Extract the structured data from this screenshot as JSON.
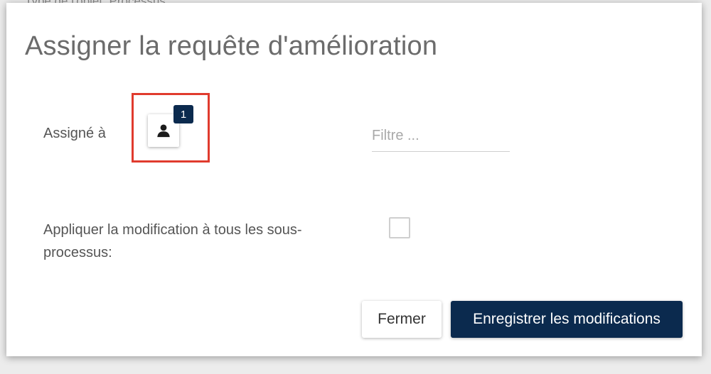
{
  "background": {
    "partial_text": "Type de l'objet: Processus"
  },
  "dialog": {
    "title": "Assigner la requête d'amélioration",
    "assign": {
      "label": "Assigné à",
      "user_count": "1",
      "filter_placeholder": "Filtre ...",
      "filter_value": ""
    },
    "apply_all": {
      "label": "Appliquer la modification à tous les sous-processus:",
      "checked": false
    },
    "buttons": {
      "close_label": "Fermer",
      "save_label": "Enregistrer les modifications"
    }
  },
  "colors": {
    "primary": "#0b2a4e",
    "highlight": "#e03b2e"
  }
}
